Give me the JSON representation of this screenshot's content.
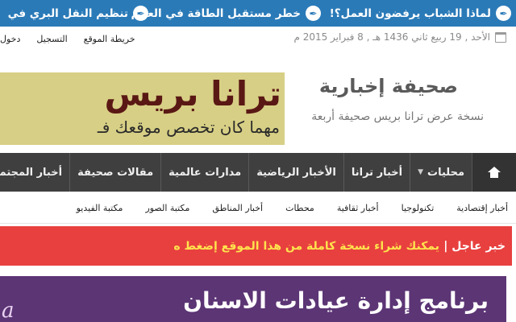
{
  "ticker": {
    "items": [
      {
        "icon": "pen-nib-icon",
        "text": "لماذا الشباب يرفضون العمل؟!"
      },
      {
        "icon": "pen-nib-icon",
        "text": "خطر مستقبل الطاقة في العالم"
      },
      {
        "icon": "pen-nib-icon",
        "text": "تنظيم النقل البري في"
      }
    ],
    "color": "#2a7ab8"
  },
  "topbar": {
    "date": "الأحد , 19 ربيع ثاني 1436 هـ , 8 فبراير 2015 م",
    "date_icon": "calendar-icon",
    "links": [
      "دخول",
      "التسجيل",
      "خريطة الموقع"
    ]
  },
  "header": {
    "site_name": "صحيفة إخبارية",
    "tagline": "نسخة عرض ترانا بريس صحيفة أربعة",
    "banner": {
      "title": "ترانا بريس",
      "subtitle": "مهما كان تخصص موقعك فـ"
    }
  },
  "mainnav": {
    "home_icon": "home-icon",
    "items": [
      {
        "label": "محليات",
        "has_dropdown": true
      },
      {
        "label": "أخبار ترانا",
        "has_dropdown": false
      },
      {
        "label": "الأخبار الرياضية",
        "has_dropdown": false
      },
      {
        "label": "مدارات عالمية",
        "has_dropdown": false
      },
      {
        "label": "مقالات صحيفة",
        "has_dropdown": false
      },
      {
        "label": "أخبار المجتمع",
        "has_dropdown": false
      }
    ],
    "background": "#3f3f3f"
  },
  "subnav": {
    "items": [
      "أخبار إقتصادية",
      "تكنولوجيا",
      "أخبار ثقافية",
      "محطات",
      "أخبار المناطق",
      "مكتبة الصور",
      "مكتبة الفيديو"
    ]
  },
  "breaking": {
    "label": "خبر عاجل |",
    "text": "يمكنك شراء نسخة كاملة من هذا الموقع إضغط ه",
    "background": "#e8403f",
    "text_color": "#ffe34d"
  },
  "ad": {
    "title": "برنامج إدارة عيادات الاسنان",
    "background": "#5c3575"
  }
}
